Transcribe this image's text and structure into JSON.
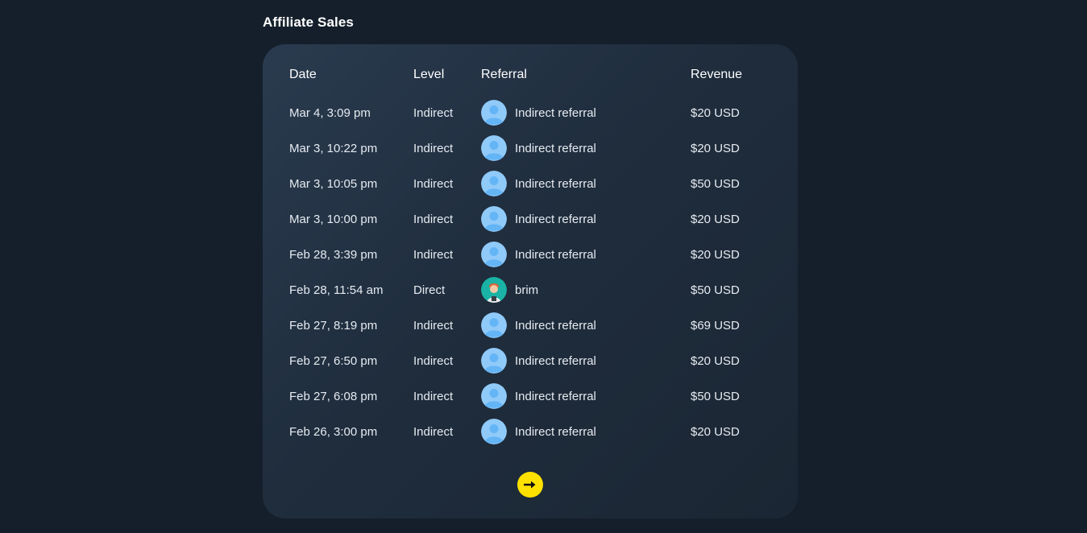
{
  "page": {
    "title": "Affiliate Sales"
  },
  "table": {
    "headers": {
      "date": "Date",
      "level": "Level",
      "referral": "Referral",
      "revenue": "Revenue"
    },
    "rows": [
      {
        "date": "Mar 4, 3:09 pm",
        "level": "Indirect",
        "referral": "Indirect referral",
        "avatar": "default-user-icon",
        "revenue": "$20 USD"
      },
      {
        "date": "Mar 3, 10:22 pm",
        "level": "Indirect",
        "referral": "Indirect referral",
        "avatar": "default-user-icon",
        "revenue": "$20 USD"
      },
      {
        "date": "Mar 3, 10:05 pm",
        "level": "Indirect",
        "referral": "Indirect referral",
        "avatar": "default-user-icon",
        "revenue": "$50 USD"
      },
      {
        "date": "Mar 3, 10:00 pm",
        "level": "Indirect",
        "referral": "Indirect referral",
        "avatar": "default-user-icon",
        "revenue": "$20 USD"
      },
      {
        "date": "Feb 28, 3:39 pm",
        "level": "Indirect",
        "referral": "Indirect referral",
        "avatar": "default-user-icon",
        "revenue": "$20 USD"
      },
      {
        "date": "Feb 28, 11:54 am",
        "level": "Direct",
        "referral": "brim",
        "avatar": "user-photo-avatar",
        "revenue": "$50 USD"
      },
      {
        "date": "Feb 27, 8:19 pm",
        "level": "Indirect",
        "referral": "Indirect referral",
        "avatar": "default-user-icon",
        "revenue": "$69 USD"
      },
      {
        "date": "Feb 27, 6:50 pm",
        "level": "Indirect",
        "referral": "Indirect referral",
        "avatar": "default-user-icon",
        "revenue": "$20 USD"
      },
      {
        "date": "Feb 27, 6:08 pm",
        "level": "Indirect",
        "referral": "Indirect referral",
        "avatar": "default-user-icon",
        "revenue": "$50 USD"
      },
      {
        "date": "Feb 26, 3:00 pm",
        "level": "Indirect",
        "referral": "Indirect referral",
        "avatar": "default-user-icon",
        "revenue": "$20 USD"
      }
    ]
  },
  "pagination": {
    "next_icon": "arrow-right-icon"
  },
  "colors": {
    "background": "#151f2b",
    "card": "#233345",
    "accent": "#ffe100",
    "avatar_default": "#90caf9"
  }
}
